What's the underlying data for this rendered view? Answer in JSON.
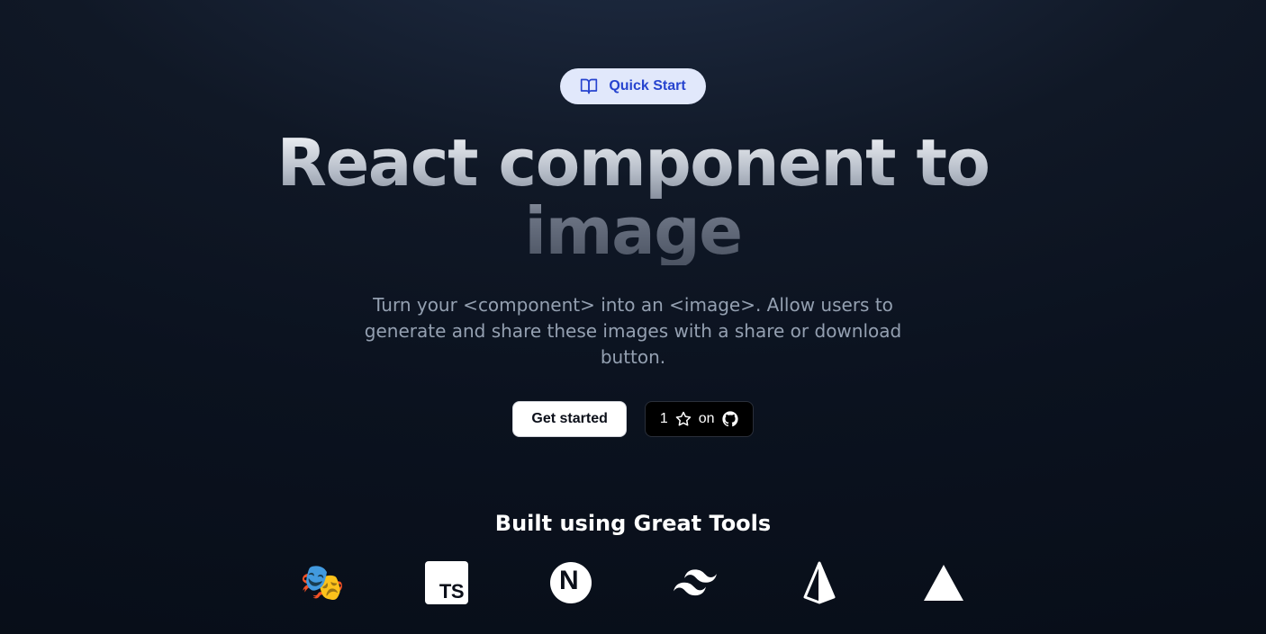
{
  "hero": {
    "quick_start_label": "Quick Start",
    "headline": "React component to image",
    "subhead": "Turn your <component> into an <image>. Allow users to generate and share these images with a share or download button.",
    "get_started_label": "Get started",
    "github": {
      "star_count": "1",
      "on_label": "on"
    }
  },
  "tools": {
    "heading": "Built using Great Tools",
    "items": [
      {
        "name": "playwright-icon"
      },
      {
        "name": "typescript-icon"
      },
      {
        "name": "nextjs-icon"
      },
      {
        "name": "tailwind-icon"
      },
      {
        "name": "prisma-icon"
      },
      {
        "name": "vercel-icon"
      }
    ]
  }
}
